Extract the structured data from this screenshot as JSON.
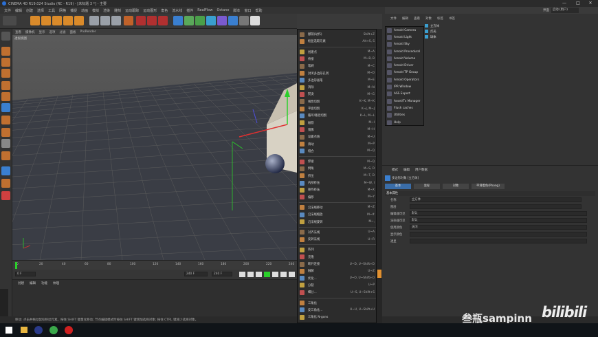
{
  "window": {
    "title": "CINEMA 4D R19.024 Studio (RC - R19) - [未标题 3 *] - 主要",
    "controls": [
      "—",
      "□",
      "✕"
    ]
  },
  "menubar": [
    "文件",
    "编辑",
    "创建",
    "选择",
    "工具",
    "网格",
    "捕捉",
    "动画",
    "模拟",
    "渲染",
    "雕刻",
    "运动跟踪",
    "运动图形",
    "角色",
    "流水线",
    "插件",
    "RealFlow",
    "Octane",
    "脚本",
    "窗口",
    "帮助"
  ],
  "layout_label": "界面",
  "layout_value": "启动 (用户)",
  "viewport": {
    "menu": [
      "查看",
      "摄像机",
      "显示",
      "选项",
      "过滤",
      "面板",
      "ProRender"
    ],
    "label": "透视视图"
  },
  "timeline": {
    "ticks": [
      "0",
      "20",
      "40",
      "60",
      "80",
      "100",
      "120",
      "140",
      "160",
      "180",
      "200",
      "220",
      "240"
    ],
    "start": "0 F",
    "end": "240 F",
    "cur": "0 F",
    "end2": "240 F"
  },
  "bottom_menu": [
    "创建",
    "编辑",
    "功能",
    "纹理"
  ],
  "status": "移动: 点击并拖动鼠标移动元素。按住 SHIFT 键量化移动; 节点编辑模式时按住 SHIFT 键增加选择对象; 按住 CTRL 键减少选择对象。",
  "ctx_menu": [
    {
      "label": "撤销(动作)",
      "sc": "Shift+Z"
    },
    {
      "label": "框显选取元素",
      "sc": "Alt+S, S"
    },
    {
      "label": "",
      "sep": true
    },
    {
      "label": "创建点",
      "sc": "M~A"
    },
    {
      "label": "桥接",
      "sc": "M~B, B"
    },
    {
      "label": "笔刷",
      "sc": "M~C"
    },
    {
      "label": "封闭多边形孔洞",
      "sc": "M~D"
    },
    {
      "label": "多边形画笔",
      "sc": "M~E"
    },
    {
      "label": "消除",
      "sc": "M~N"
    },
    {
      "label": "熨烫",
      "sc": "M~G"
    },
    {
      "label": "线性切割",
      "sc": "K~K, M~K"
    },
    {
      "label": "平面切割",
      "sc": "K~J, M~J"
    },
    {
      "label": "循环/路径切割",
      "sc": "K~L, M~L"
    },
    {
      "label": "磁铁",
      "sc": "M~I"
    },
    {
      "label": "镜像",
      "sc": "M~H"
    },
    {
      "label": "设置点值",
      "sc": "M~U"
    },
    {
      "label": "滑动",
      "sc": "M~P"
    },
    {
      "label": "缝合",
      "sc": "M~Q"
    },
    {
      "label": "",
      "sep": true
    },
    {
      "label": "焊接",
      "sc": "M~Q"
    },
    {
      "label": "倒角",
      "sc": "M~S, D"
    },
    {
      "label": "挤压",
      "sc": "M~T, D"
    },
    {
      "label": "内部挤压",
      "sc": "M~W, I"
    },
    {
      "label": "矩阵挤压",
      "sc": "M~X"
    },
    {
      "label": "偏移",
      "sc": "M~Y"
    },
    {
      "label": "",
      "sep": true
    },
    {
      "label": "沿法线移动",
      "sc": "M~Z"
    },
    {
      "label": "沿法线缩放",
      "sc": "M~#"
    },
    {
      "label": "沿法线旋转",
      "sc": "M~,"
    },
    {
      "label": "",
      "sep": true
    },
    {
      "label": "对齐法线",
      "sc": "U~A"
    },
    {
      "label": "反转法线",
      "sc": "U~R"
    },
    {
      "label": "",
      "sep": true
    },
    {
      "label": "阵列",
      "sc": ""
    },
    {
      "label": "克隆",
      "sc": ""
    },
    {
      "label": "断开连接",
      "sc": "U~D, U~Shift+D"
    },
    {
      "label": "融解",
      "sc": "U~Z"
    },
    {
      "label": "优化...",
      "sc": "U~O, U~Shift+O"
    },
    {
      "label": "分裂",
      "sc": "U~P"
    },
    {
      "label": "细分...",
      "sc": "U~S, U~Shift+S"
    },
    {
      "label": "",
      "sep": true
    },
    {
      "label": "三角化",
      "sc": ""
    },
    {
      "label": "反三角化...",
      "sc": "U~U, U~Shift+U"
    },
    {
      "label": "三角化 N-gons",
      "sc": ""
    }
  ],
  "dropdown": [
    "Arnold Camera",
    "Arnold Light",
    "Arnold Sky",
    "Arnold Procedural",
    "Arnold Volume",
    "Arnold Driver",
    "Arnold TP Group",
    "Arnold Operators",
    "IPR Window",
    "ASS Export",
    "Asset/Tx Manager",
    "Flush caches",
    "Utilities",
    "Help"
  ],
  "object_manager": {
    "menu": [
      "文件",
      "编辑",
      "查看",
      "对象",
      "标签",
      "书签"
    ],
    "objects": [
      "立方体",
      "灯光",
      "球体"
    ]
  },
  "attributes": {
    "menu": [
      "模式",
      "编辑",
      "用户数据"
    ],
    "object_title": "多边形对象 [立方体]",
    "tabs": [
      "基本",
      "坐标",
      "对象",
      "平滑着色(Phong)"
    ],
    "section": "基本属性",
    "fields": [
      {
        "label": "名称",
        "value": "立方体"
      },
      {
        "label": "图层",
        "value": ""
      },
      {
        "label": "编辑器可见",
        "value": "默认"
      },
      {
        "label": "渲染器可见",
        "value": "默认"
      },
      {
        "label": "使用颜色",
        "value": "关闭"
      },
      {
        "label": "显示颜色",
        "value": ""
      },
      {
        "label": "透显",
        "value": ""
      }
    ]
  },
  "watermark": "叁瓶sampinn",
  "bili": "bilibili",
  "accent": "#ff8c1a"
}
